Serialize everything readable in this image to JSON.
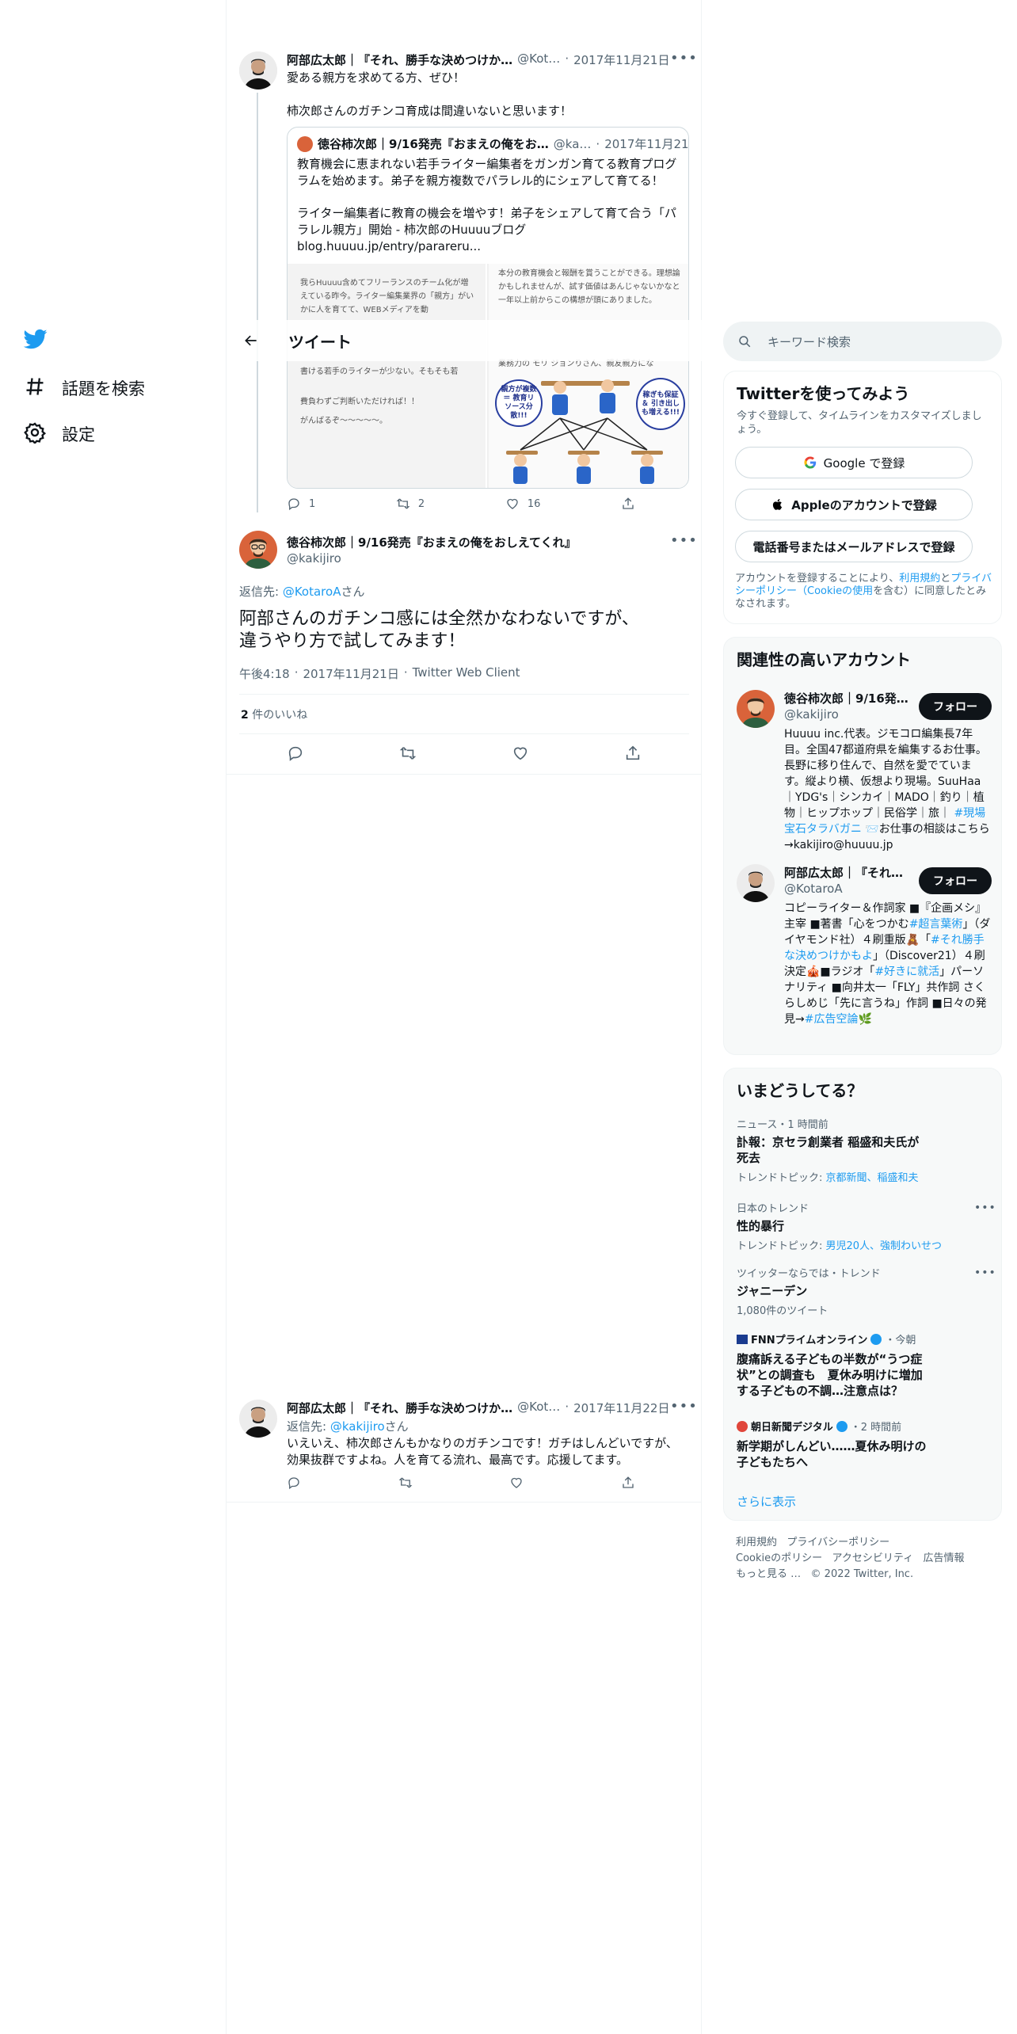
{
  "nav": {
    "explore_label": "話題を検索",
    "settings_label": "設定"
  },
  "header": {
    "title": "ツイート"
  },
  "tweet1": {
    "name": "阿部広太郎｜『それ、勝手な決めつけか…",
    "handle": "@Kot…",
    "date": "2017年11月21日",
    "line1": "愛ある親方を求めてる方、ぜひ！",
    "line2": "柿次郎さんのガチンコ育成は間違いないと思います！",
    "quote": {
      "name": "徳谷柿次郎｜9/16発売『おまえの俺をお…",
      "handle": "@ka…",
      "date": "2017年11月21日",
      "text1": "教育機会に恵まれない若手ライター編集者をガンガン育てる教育プログラムを始めます。弟子を親方複数でパラレル的にシェアして育てる！",
      "text2": "ライター編集者に教育の機会を増やす！弟子をシェアして育て合う「パラレル親方」開始 - 柿次郎のHuuuuブログ",
      "url": "blog.huuuu.jp/entry/parareru...",
      "img_left_1": "我らHuuuu含めてフリーランスのチーム化が増えている昨今。ライター編集業界の「親方」がいかに人を育てて、WEBメディアを動",
      "img_left_2": "書ける若手のライターが少ない。そもそも若",
      "img_left_3": "費負わずご判断いただければ！！",
      "img_left_4": "がんばるぞ〜〜〜〜〜。",
      "img_right_1": "本分の教育機会と報酬を賞うことができる。理想論かもしれませんが、試す価値はあんじゃないかなと一年以上前からこの構想が頭にありました。",
      "img_right_2": "業務力の モリ ジョンりさん、親友親方にな",
      "bubble1": "親方が複数 ＝ 教育リソース分散!!!",
      "bubble2": "稼ぎも保証 ＆ 引き出しも増える!!!"
    },
    "replies": "1",
    "retweets": "2",
    "likes": "16"
  },
  "main_tweet": {
    "name": "徳谷柿次郎｜9/16発売『おまえの俺をおしえてくれ』",
    "handle": "@kakijiro",
    "reply_prefix": "返信先:",
    "reply_to": "@KotaroA",
    "reply_suffix": "さん",
    "text_line1": "阿部さんのガチンコ感には全然かなわないですが、",
    "text_line2": "違うやり方で試してみます！",
    "time": "午後4:18",
    "date": "2017年11月21日",
    "client": "Twitter Web Client",
    "likes_count": "2",
    "likes_label": "件のいいね"
  },
  "reply_tweet": {
    "name": "阿部広太郎｜『それ、勝手な決めつけか…",
    "handle": "@Kot…",
    "date": "2017年11月22日",
    "reply_prefix": "返信先:",
    "reply_to": "@kakijiro",
    "reply_suffix": "さん",
    "text_line1": "いえいえ、柿次郎さんもかなりのガチンコです！ガチはしんどいですが、",
    "text_line2": "効果抜群ですよね。人を育てる流れ、最高です。応援してます。"
  },
  "search": {
    "placeholder": "キーワード検索"
  },
  "signup": {
    "title": "Twitterを使ってみよう",
    "subtitle": "今すぐ登録して、タイムラインをカスタマイズしましょう。",
    "google": "Google で登録",
    "apple": "Appleのアカウントで登録",
    "phone": "電話番号またはメールアドレスで登録",
    "terms_1": "アカウントを登録することにより、",
    "terms_link1": "利用規約",
    "terms_2": "と",
    "terms_link2": "プライバシーポリシー（Cookieの使用",
    "terms_3": "を含む）に同意したとみなされます。"
  },
  "related": {
    "title": "関連性の高いアカウント",
    "follow_label": "フォロー",
    "acct1": {
      "name": "徳谷柿次郎｜9/16発…",
      "handle": "@kakijiro",
      "bio_a": "Huuuu inc.代表。ジモコロ編集長7年目。全国47都道府県を編集するお仕事。長野に移り住んで、自然を愛でています。縦より横、仮想より現場。SuuHaa｜YDG's｜シンカイ｜MADO｜釣り｜植物｜ヒップホップ｜民俗学｜旅｜ ",
      "bio_link": "#現場宝石タラバガニ",
      "bio_b": " 📨お仕事の相談はこちら→kakijiro@huuuu.jp"
    },
    "acct2": {
      "name": "阿部広太郎｜『それ…",
      "handle": "@KotaroA",
      "bio_a": "コピーライター＆作詞家 ■『企画メシ』主宰 ■著書「心をつかむ",
      "bio_link1": "#超言葉術",
      "bio_b": "」（ダイヤモンド社）４刷重版🧸「",
      "bio_link2": "#それ勝手な決めつけかもよ",
      "bio_c": "」（Discover21）４刷決定🎪■ラジオ「",
      "bio_link3": "#好きに就活",
      "bio_d": "」パーソナリティ ■向井太一「FLY」共作詞 さくらしめじ「先に言うね」作詞 ■日々の発見→",
      "bio_link4": "#広告空論",
      "bio_e": "🌿"
    }
  },
  "trends": {
    "title": "いまどうしてる？",
    "t1_cat": "ニュース・1 時間前",
    "t1_title": "訃報：京セラ創業者 稲盛和夫氏が死去",
    "t1_sub_prefix": "トレンドトピック: ",
    "t1_sub_links": "京都新聞、稲盛和夫",
    "t2_cat": "日本のトレンド",
    "t2_title": "性的暴行",
    "t2_sub_prefix": "トレンドトピック: ",
    "t2_sub_links": "男児20人、強制わいせつ",
    "t3_cat": "ツイッターならでは・トレンド",
    "t3_title": "ジャニーデン",
    "t3_sub": "1,080件のツイート",
    "t4_src": "FNNプライムオンライン",
    "t4_time": "・今朝",
    "t4_title": "腹痛訴える子どもの半数が“うつ症状”との調査も　夏休み明けに増加する子どもの不調…注意点は？",
    "t5_src": "朝日新聞デジタル",
    "t5_time": "・2 時間前",
    "t5_title": "新学期がしんどい……夏休み明けの子どもたちへ",
    "show_more": "さらに表示"
  },
  "footer": {
    "l1": "利用規約",
    "l2": "プライバシーポリシー",
    "l3": "Cookieのポリシー",
    "l4": "アクセシビリティ",
    "l5": "広告情報",
    "l6": "もっと見る …",
    "copy": "© 2022 Twitter, Inc."
  },
  "colors": {
    "accent": "#1d9bf0",
    "text": "#0f1419",
    "muted": "#536471",
    "border": "#eff3f4"
  }
}
